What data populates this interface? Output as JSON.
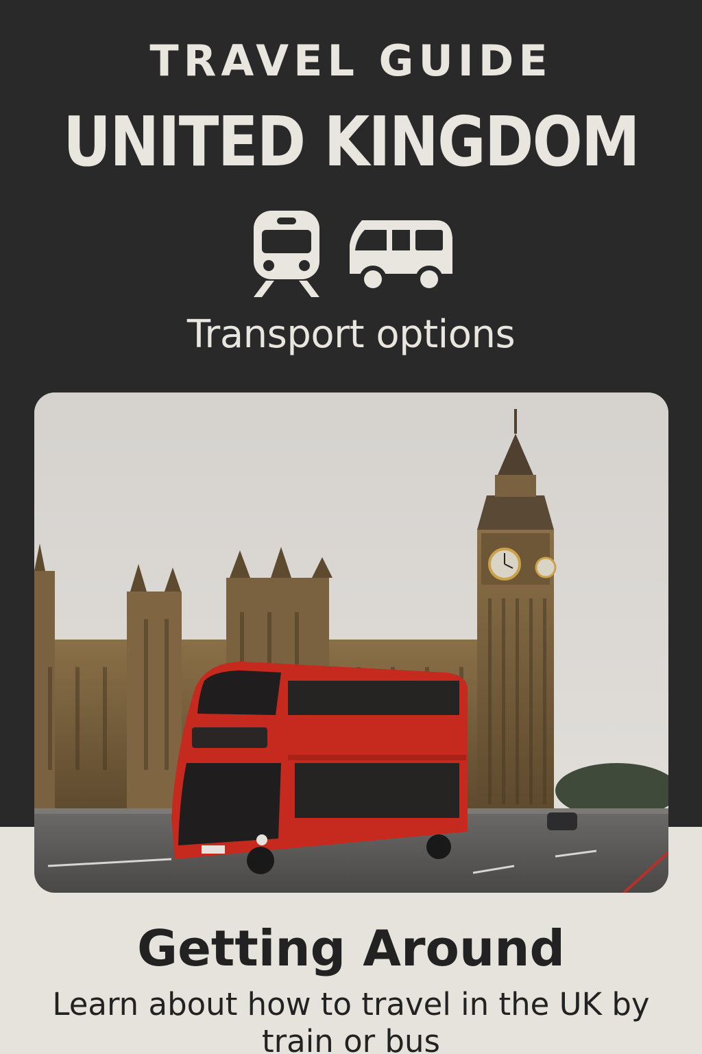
{
  "header": {
    "kicker": "TRAVEL GUIDE",
    "title": "UNITED KINGDOM",
    "icons": [
      "train-icon",
      "bus-icon"
    ],
    "subtitle": "Transport options"
  },
  "hero_image": {
    "depicts": [
      "big-ben-clock-tower",
      "houses-of-parliament",
      "red-double-decker-bus"
    ]
  },
  "section": {
    "title": "Getting Around",
    "body": "Learn about how to travel in the UK by train or bus"
  },
  "colors": {
    "header_bg": "#2a2929",
    "page_bg": "#e6e2dc",
    "light_text": "#e9e5df",
    "dark_text": "#222222",
    "bus_red": "#c62a1f"
  }
}
